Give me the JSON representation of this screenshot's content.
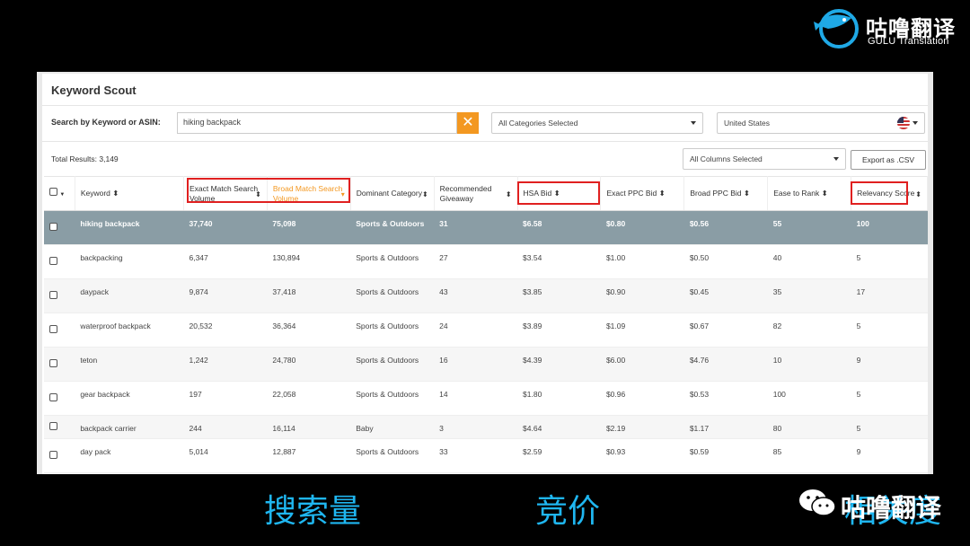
{
  "logo": {
    "cn": "咕噜翻译",
    "en": "GULU Translation"
  },
  "app": {
    "title": "Keyword Scout"
  },
  "search": {
    "label": "Search by Keyword or ASIN:",
    "value": "hiking backpack",
    "clear_glyph": "✕",
    "categories": "All Categories Selected",
    "country": "United States"
  },
  "results": {
    "total": "Total Results:  3,149",
    "columns_select": "All Columns Selected",
    "export": "Export as .CSV"
  },
  "headers": [
    "Keyword",
    "Exact Match Search Volume",
    "Broad Match Search Volume",
    "Dominant Category",
    "Recommended Giveaway",
    "HSA Bid",
    "Exact PPC Bid",
    "Broad PPC Bid",
    "Ease to Rank",
    "Relevancy Score"
  ],
  "rows": [
    [
      "hiking backpack",
      "37,740",
      "75,098",
      "Sports & Outdoors",
      "31",
      "$6.58",
      "$0.80",
      "$0.56",
      "55",
      "100"
    ],
    [
      "backpacking",
      "6,347",
      "130,894",
      "Sports & Outdoors",
      "27",
      "$3.54",
      "$1.00",
      "$0.50",
      "40",
      "5"
    ],
    [
      "daypack",
      "9,874",
      "37,418",
      "Sports & Outdoors",
      "43",
      "$3.85",
      "$0.90",
      "$0.45",
      "35",
      "17"
    ],
    [
      "waterproof backpack",
      "20,532",
      "36,364",
      "Sports & Outdoors",
      "24",
      "$3.89",
      "$1.09",
      "$0.67",
      "82",
      "5"
    ],
    [
      "teton",
      "1,242",
      "24,780",
      "Sports & Outdoors",
      "16",
      "$4.39",
      "$6.00",
      "$4.76",
      "10",
      "9"
    ],
    [
      "gear backpack",
      "197",
      "22,058",
      "Sports & Outdoors",
      "14",
      "$1.80",
      "$0.96",
      "$0.53",
      "100",
      "5"
    ],
    [
      "backpack carrier",
      "244",
      "16,114",
      "Baby",
      "3",
      "$4.64",
      "$2.19",
      "$1.17",
      "80",
      "5"
    ],
    [
      "day pack",
      "5,014",
      "12,887",
      "Sports & Outdoors",
      "33",
      "$2.59",
      "$0.93",
      "$0.59",
      "85",
      "9"
    ]
  ],
  "captions": {
    "volume": "搜索量",
    "bid": "竞价",
    "relevancy": "相关度",
    "watermark": "咕噜翻译"
  },
  "colors": {
    "accent_orange": "#f39821",
    "highlight_row": "#8a9da5",
    "caption_blue": "#1fb6f0",
    "annotation_red": "#e02020"
  }
}
